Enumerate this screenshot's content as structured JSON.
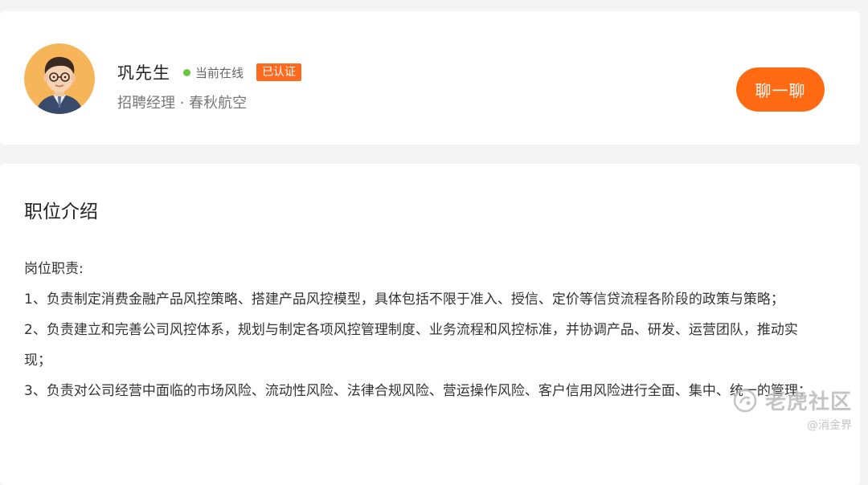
{
  "recruiter": {
    "name": "巩先生",
    "status": "当前在线",
    "verified_badge": "已认证",
    "title": "招聘经理 · 春秋航空",
    "chat_button": "聊一聊",
    "status_color": "#6cc644",
    "accent_color": "#ff6a13"
  },
  "job": {
    "section_title": "职位介绍",
    "lines": [
      "岗位职责:",
      "1、负责制定消费金融产品风控策略、搭建产品风控模型，具体包括不限于准入、授信、定价等信贷流程各阶段的政策与策略；",
      "2、负责建立和完善公司风控体系，规划与制定各项风控管理制度、业务流程和风控标准，并协调产品、研发、运营团队，推动实现；",
      "3、负责对公司经营中面临的市场风险、流动性风险、法律合规风险、营运操作风险、客户信用风险进行全面、集中、统一的管理；"
    ]
  },
  "watermark": {
    "main": "老虎社区",
    "sub": "@消金界"
  }
}
